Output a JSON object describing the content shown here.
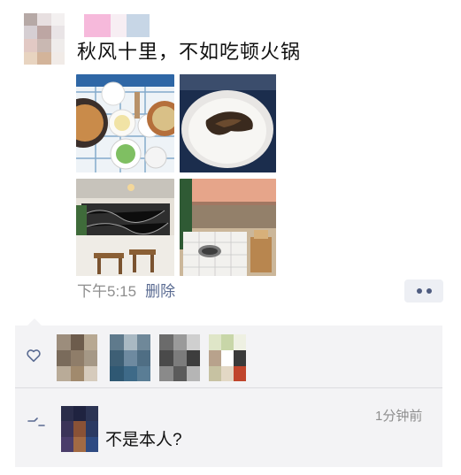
{
  "post": {
    "text": "秋风十里，不如吃顿火锅",
    "time": "下午5:15",
    "delete_label": "删除"
  },
  "interactions": {
    "comment": {
      "time": "1分钟前",
      "text": "不是本人?"
    }
  },
  "icons": {
    "more": "more-dots-icon",
    "like": "heart-outline-icon",
    "comment": "comment-bubble-icon"
  },
  "colors": {
    "link": "#5a6b92",
    "meta_gray": "#8e8e8e",
    "panel_bg": "#f3f3f5"
  }
}
